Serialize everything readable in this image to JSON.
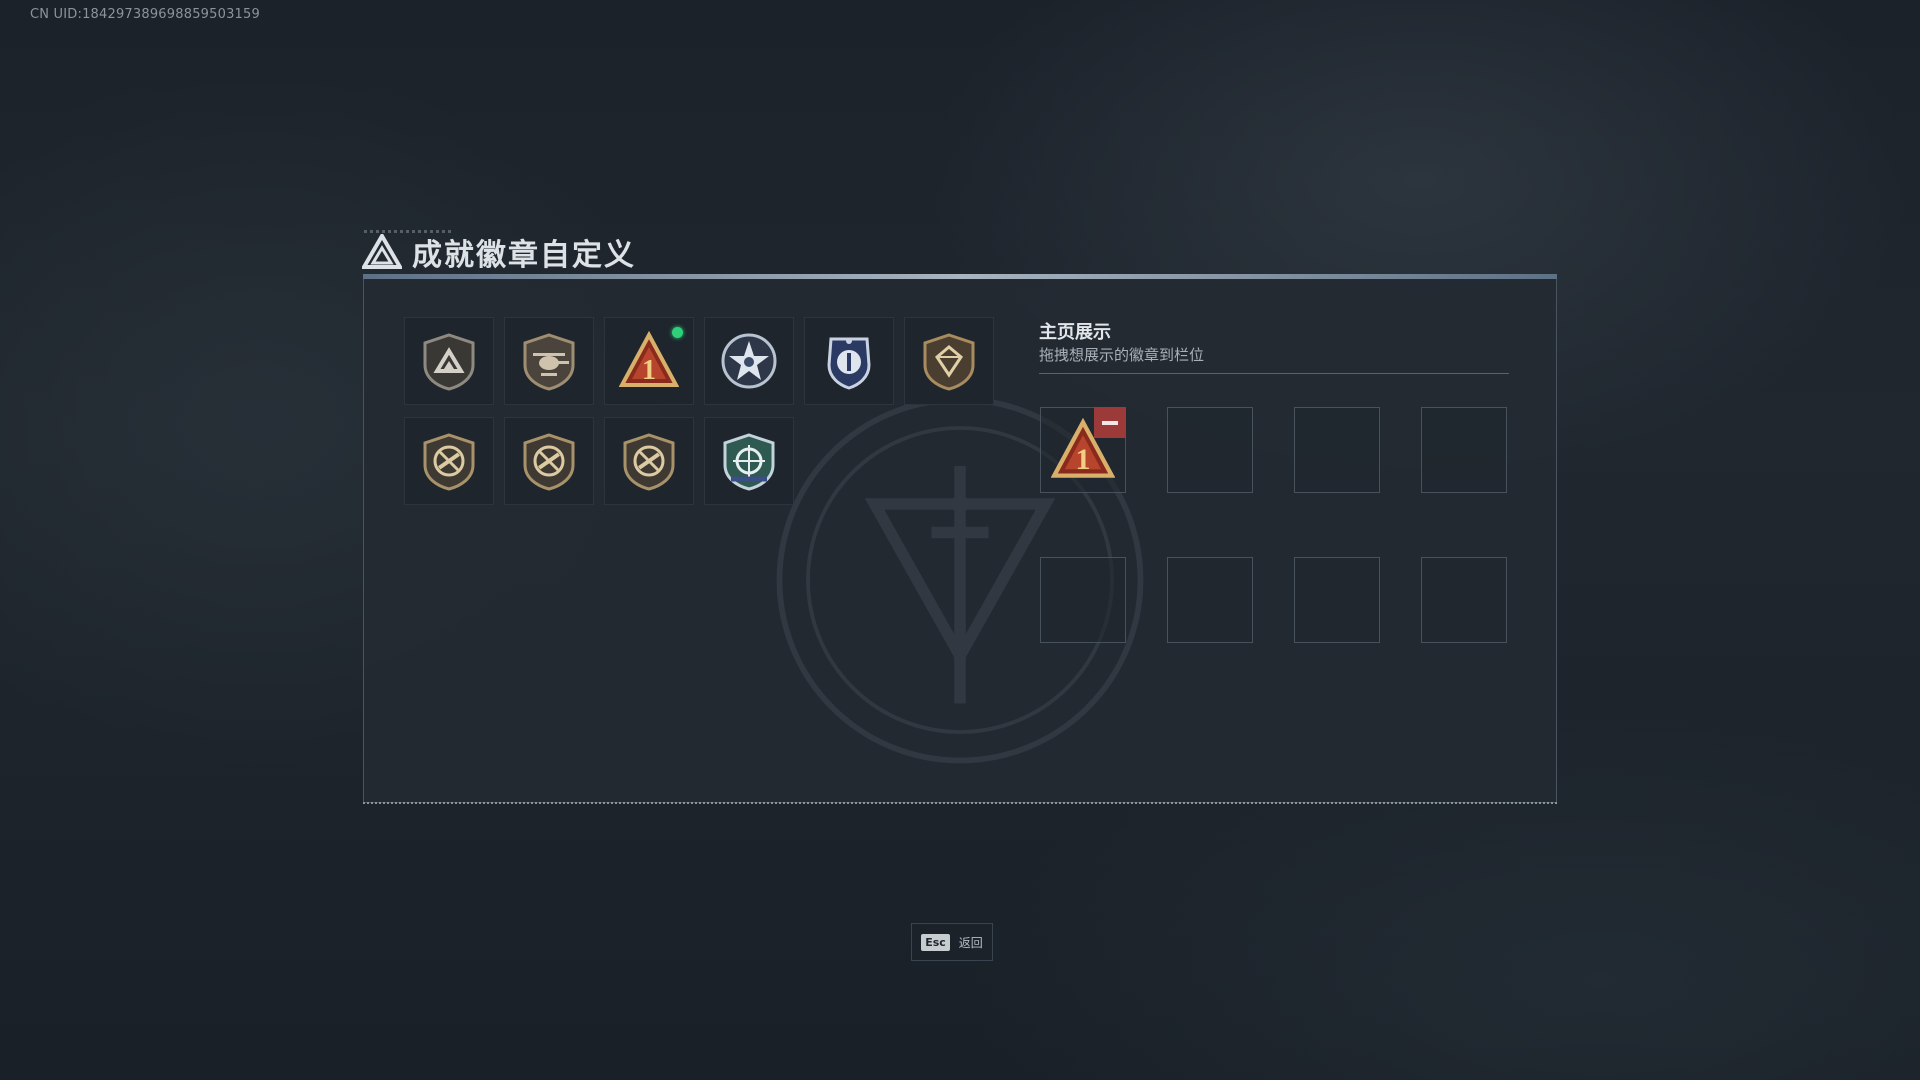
{
  "uid": "CN UID:18429738969885950315​9",
  "title": "成就徽章自定义",
  "badges": [
    {
      "icon": "triangle-shield-badge-icon",
      "new": false
    },
    {
      "icon": "helicopter-badge-icon",
      "new": false
    },
    {
      "icon": "rank-one-badge-icon",
      "new": true
    },
    {
      "icon": "star-seal-badge-icon",
      "new": false
    },
    {
      "icon": "blue-police-badge-icon",
      "new": false
    },
    {
      "icon": "diamond-shield-badge-icon",
      "new": false
    },
    {
      "icon": "no-rifle-badge-icon",
      "new": false
    },
    {
      "icon": "no-rifle-badge-icon",
      "new": false
    },
    {
      "icon": "no-rifle-badge-icon",
      "new": false
    },
    {
      "icon": "crosshair-shield-badge-icon",
      "new": false
    }
  ],
  "showcase": {
    "title": "主页展示",
    "subtitle": "拖拽想展示的徽章到栏位",
    "slots": [
      "rank-one-badge-icon",
      "",
      "",
      "",
      "",
      "",
      "",
      ""
    ]
  },
  "footer": {
    "key": "Esc",
    "label": "返回"
  },
  "colors": {
    "accent_green": "#2fd07a",
    "remove_red": "#9c3a3a",
    "badge_gold": "#c9a56a"
  }
}
